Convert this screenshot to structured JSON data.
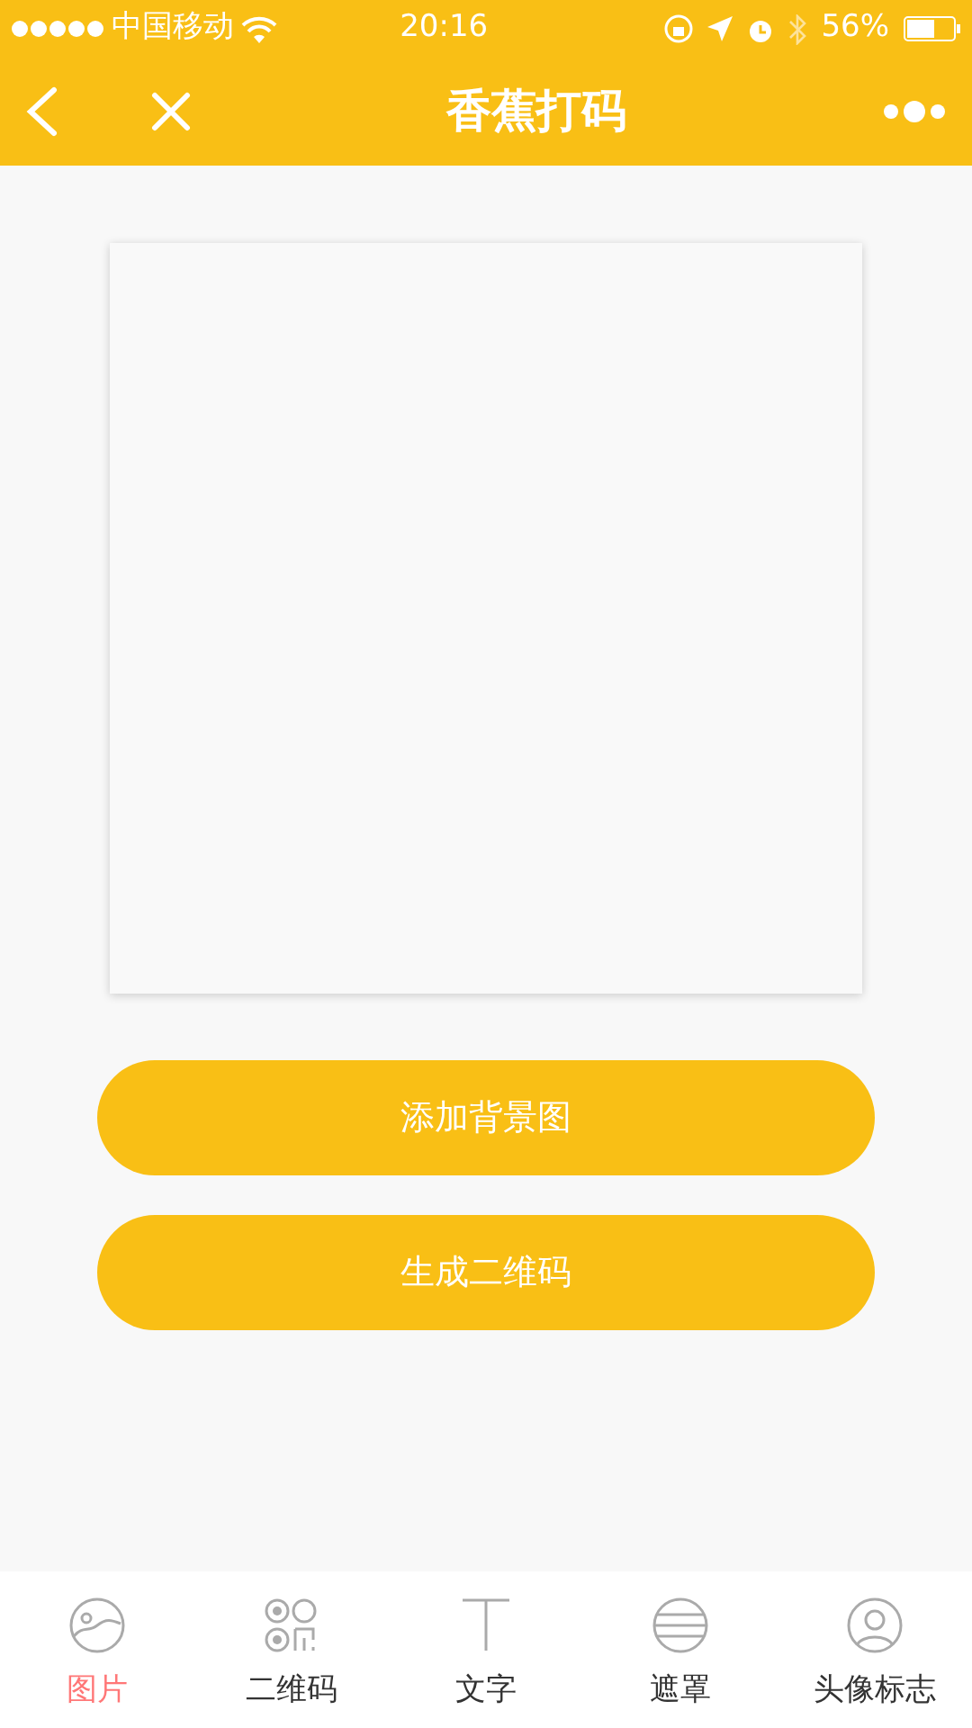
{
  "status_bar": {
    "carrier": "中国移动",
    "time": "20:16",
    "battery": "56%"
  },
  "nav_bar": {
    "title": "香蕉打码"
  },
  "buttons": [
    "添加背景图",
    "生成二维码"
  ],
  "tabs": [
    {
      "label": "图片",
      "kind": "picture",
      "selected": true
    },
    {
      "label": "二维码",
      "kind": "qr",
      "selected": false
    },
    {
      "label": "文字",
      "kind": "text",
      "selected": false
    },
    {
      "label": "遮罩",
      "kind": "mask",
      "selected": false
    },
    {
      "label": "头像标志",
      "kind": "avatar",
      "selected": false
    }
  ]
}
